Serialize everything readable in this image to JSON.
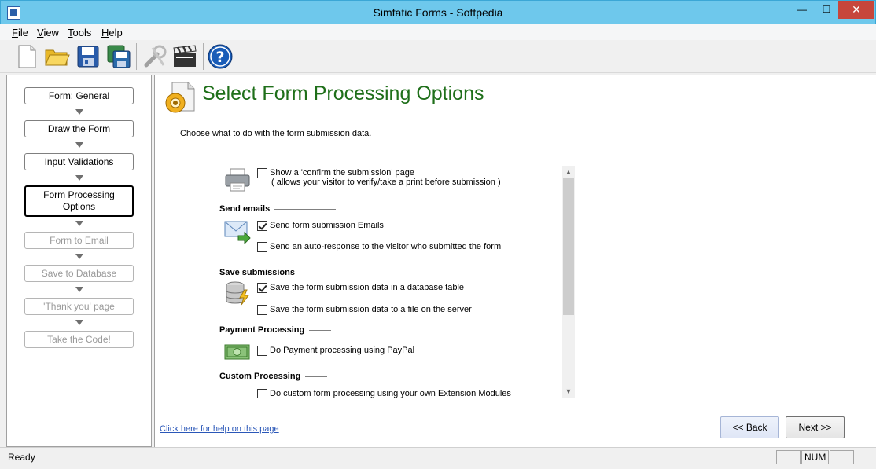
{
  "window": {
    "title": "Simfatic Forms - Softpedia",
    "min_glyph": "—",
    "max_glyph": "☐",
    "close_glyph": "✕"
  },
  "menu": [
    {
      "key": "F",
      "rest": "ile"
    },
    {
      "key": "V",
      "rest": "iew"
    },
    {
      "key": "T",
      "rest": "ools"
    },
    {
      "key": "H",
      "rest": "elp"
    }
  ],
  "toolbar": {
    "icons": [
      "new-document-icon",
      "open-folder-icon",
      "save-icon",
      "save-as-icon",
      "settings-tool-icon",
      "clapperboard-icon",
      "help-icon"
    ]
  },
  "steps": [
    {
      "label": "Form: General",
      "state": "enabled"
    },
    {
      "label": "Draw the Form",
      "state": "enabled"
    },
    {
      "label": "Input Validations",
      "state": "enabled"
    },
    {
      "label": "Form Processing Options",
      "state": "active"
    },
    {
      "label": "Form to Email",
      "state": "disabled"
    },
    {
      "label": "Save to Database",
      "state": "disabled"
    },
    {
      "label": "'Thank you' page",
      "state": "disabled"
    },
    {
      "label": "Take the Code!",
      "state": "disabled"
    }
  ],
  "page": {
    "title": "Select Form Processing Options",
    "subtitle": "Choose what to do with the form submission data."
  },
  "options": {
    "confirm_page": {
      "label": "Show a 'confirm the submission' page",
      "sub": "( allows your visitor to verify/take a print before submission )",
      "checked": false
    },
    "send_emails_header": "Send emails",
    "send_emails": {
      "label": "Send form submission Emails",
      "checked": true
    },
    "auto_response": {
      "label": "Send an auto-response to the visitor who submitted the form",
      "checked": false
    },
    "save_header": "Save submissions",
    "save_db": {
      "label": "Save the form submission data in a database table",
      "checked": true
    },
    "save_file": {
      "label": "Save the form submission data to a file on the server",
      "checked": false
    },
    "payment_header": "Payment Processing",
    "paypal": {
      "label": "Do Payment processing using PayPal",
      "checked": false
    },
    "custom_header": "Custom Processing",
    "custom": {
      "label": "Do custom form processing using your own Extension Modules",
      "checked": false
    }
  },
  "footer": {
    "help_link": "Click here for help on this page",
    "back": "<< Back",
    "next": "Next >>"
  },
  "status": {
    "text": "Ready",
    "num": "NUM"
  },
  "colors": {
    "title_green": "#1f6f1a",
    "titlebar": "#6ec8ec",
    "close_red": "#c7463c",
    "link_blue": "#2a57b8"
  }
}
